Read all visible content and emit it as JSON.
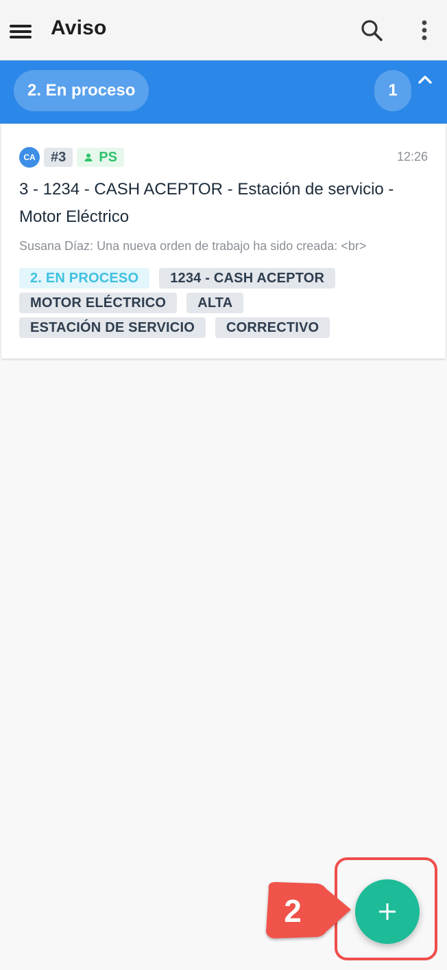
{
  "app_bar": {
    "title": "Aviso",
    "menu_icon": "menu-icon",
    "search_icon": "search-icon",
    "more_icon": "more-vert-icon"
  },
  "group": {
    "label": "2. En proceso",
    "count": "1",
    "collapse_icon": "chevron-up-icon",
    "color": "#2b87e8"
  },
  "card": {
    "avatar_initials": "CA",
    "id": "#3",
    "user_icon": "person-icon",
    "user_initials": "PS",
    "time": "12:26",
    "title": "3 - 1234 - CASH ACEPTOR - Estación de servicio - Motor Eléctrico",
    "message": "Susana Díaz: Una nueva orden de trabajo ha sido creada: <br>",
    "tags": [
      {
        "label": "2. EN PROCESO",
        "kind": "status"
      },
      {
        "label": "1234 - CASH ACEPTOR",
        "kind": "default"
      },
      {
        "label": "MOTOR ELÉCTRICO",
        "kind": "default"
      },
      {
        "label": "ALTA",
        "kind": "default"
      },
      {
        "label": "ESTACIÓN DE SERVICIO",
        "kind": "default"
      },
      {
        "label": "CORRECTIVO",
        "kind": "default"
      }
    ]
  },
  "fab": {
    "icon": "plus-icon",
    "color": "#1dbb98"
  },
  "annotation": {
    "step_number": "2",
    "color": "#ee4e4a"
  }
}
